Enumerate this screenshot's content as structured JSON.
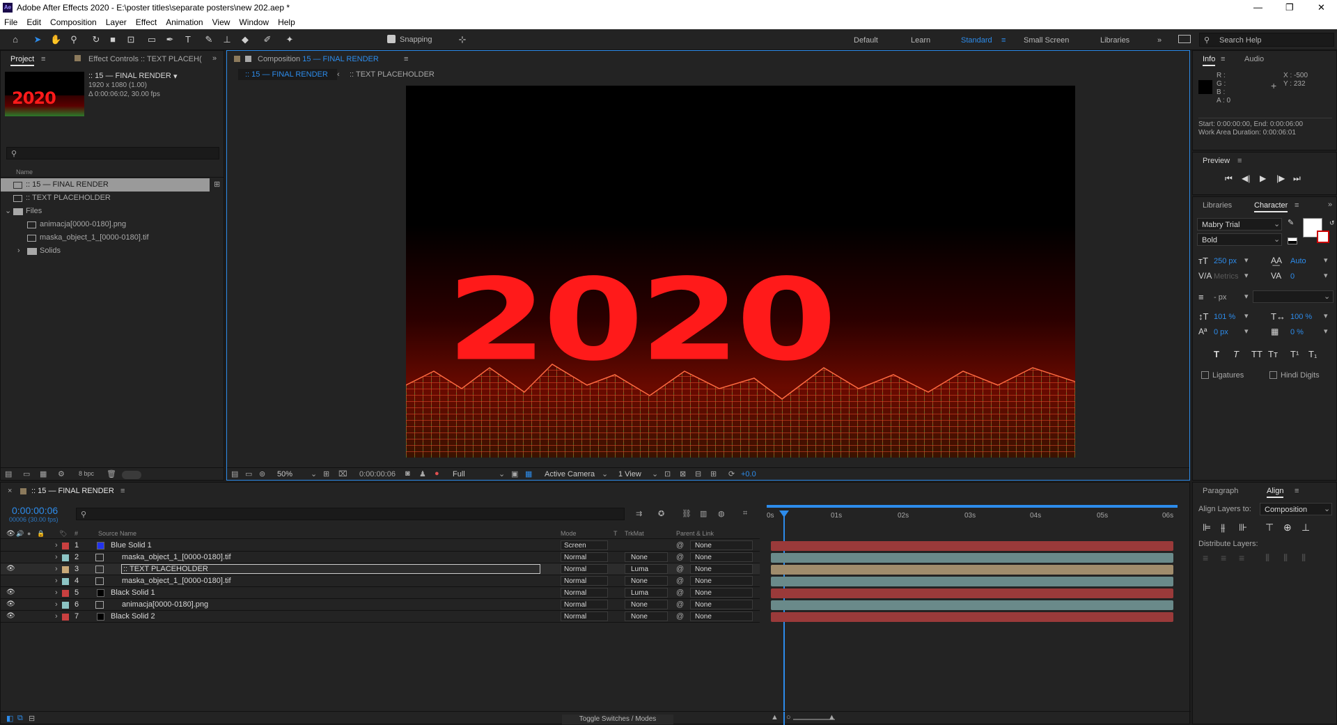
{
  "window": {
    "title": "Adobe After Effects 2020 - E:\\poster titles\\separate posters\\new 202.aep *",
    "app_icon": "Ae",
    "minimize": "—",
    "maximize": "❐",
    "close": "✕"
  },
  "menu": [
    "File",
    "Edit",
    "Composition",
    "Layer",
    "Effect",
    "Animation",
    "View",
    "Window",
    "Help"
  ],
  "toolbar": {
    "snapping": "Snapping",
    "workspaces": [
      "Default",
      "Learn",
      "Standard",
      "Small Screen",
      "Libraries"
    ],
    "active_workspace": "Standard",
    "search_placeholder": "Search Help"
  },
  "project": {
    "tab": "Project",
    "effect_tab": "Effect Controls :: TEXT PLACEH(",
    "comp_name": ":: 15 — FINAL RENDER",
    "comp_res": "1920 x 1080 (1.00)",
    "comp_dur": "Δ 0:00:06:02, 30.00 fps",
    "thumb_text": "2020",
    "col_name": "Name",
    "items": [
      {
        "label": ":: 15 — FINAL RENDER",
        "indent": 0
      },
      {
        "label": ":: TEXT PLACEHOLDER",
        "indent": 0
      },
      {
        "label": "Files",
        "indent": 0
      },
      {
        "label": "animacja[0000-0180].png",
        "indent": 1
      },
      {
        "label": "maska_object_1_[0000-0180].tif",
        "indent": 1
      },
      {
        "label": "Solids",
        "indent": 1
      }
    ],
    "bpc": "8 bpc"
  },
  "composition": {
    "tab_prefix": "Composition",
    "tab_name": "15 — FINAL RENDER",
    "crumbs": [
      ":: 15 — FINAL RENDER",
      ":: TEXT PLACEHOLDER"
    ],
    "art_text": "2020",
    "zoom": "50%",
    "timecode": "0:00:00:06",
    "resolution": "Full",
    "camera": "Active Camera",
    "views": "1 View",
    "exposure": "+0.0"
  },
  "info": {
    "tab": "Info",
    "audio_tab": "Audio",
    "r": "R :",
    "g": "G :",
    "b": "B :",
    "a": "A : 0",
    "x": "X : -500",
    "y": "Y : 232",
    "start": "Start: 0:00:00:00, End: 0:00:06:00",
    "work": "Work Area Duration: 0:00:06:01"
  },
  "preview": {
    "tab": "Preview"
  },
  "character": {
    "lib_tab": "Libraries",
    "tab": "Character",
    "font": "Mabry Trial",
    "style": "Bold",
    "size": "250 px",
    "leading": "Auto",
    "kerning": "Metrics",
    "tracking": "0",
    "stroke": "- px",
    "vscale": "101 %",
    "hscale": "100 %",
    "baseline": "0 px",
    "tsume": "0 %",
    "styles": [
      "T",
      "T",
      "TT",
      "Tт",
      "T¹",
      "T₁"
    ],
    "ligatures": "Ligatures",
    "hindi": "Hindi Digits"
  },
  "align": {
    "para_tab": "Paragraph",
    "tab": "Align",
    "align_to_label": "Align Layers to:",
    "align_to": "Composition",
    "distribute": "Distribute Layers:"
  },
  "timeline": {
    "tab": ":: 15 — FINAL RENDER",
    "timecode": "0:00:00:06",
    "frames": "00006 (30.00 fps)",
    "headers": {
      "num": "#",
      "source": "Source Name",
      "mode": "Mode",
      "t": "T",
      "trkmat": "TrkMat",
      "parent": "Parent & Link"
    },
    "ruler": [
      "0s",
      "01s",
      "02s",
      "03s",
      "04s",
      "05s",
      "06s"
    ],
    "layers": [
      {
        "n": "1",
        "name": "Blue Solid 1",
        "label_color": "#c94040",
        "icon_color": "#2233ee",
        "mode": "Screen",
        "trkmat": "",
        "parent": "None",
        "bar": "#9a3a3a",
        "eye": ""
      },
      {
        "n": "2",
        "name": "maska_object_1_[0000-0180].tif",
        "label_color": "#8cc4c4",
        "icon_color": "",
        "mode": "Normal",
        "trkmat": "None",
        "parent": "None",
        "bar": "#6a8a8a",
        "eye": ""
      },
      {
        "n": "3",
        "name": ":: TEXT PLACEHOLDER",
        "label_color": "#c8a878",
        "icon_color": "",
        "mode": "Normal",
        "trkmat": "Luma",
        "parent": "None",
        "bar": "#a08c6c",
        "eye": "👁"
      },
      {
        "n": "4",
        "name": "maska_object_1_[0000-0180].tif",
        "label_color": "#8cc4c4",
        "icon_color": "",
        "mode": "Normal",
        "trkmat": "None",
        "parent": "None",
        "bar": "#6a8a8a",
        "eye": ""
      },
      {
        "n": "5",
        "name": "Black Solid 1",
        "label_color": "#c94040",
        "icon_color": "#000000",
        "mode": "Normal",
        "trkmat": "Luma",
        "parent": "None",
        "bar": "#9a3a3a",
        "eye": "👁"
      },
      {
        "n": "6",
        "name": "animacja[0000-0180].png",
        "label_color": "#8cc4c4",
        "icon_color": "",
        "mode": "Normal",
        "trkmat": "None",
        "parent": "None",
        "bar": "#6a8a8a",
        "eye": "👁"
      },
      {
        "n": "7",
        "name": "Black Solid 2",
        "label_color": "#c94040",
        "icon_color": "#000000",
        "mode": "Normal",
        "trkmat": "None",
        "parent": "None",
        "bar": "#9a3a3a",
        "eye": "👁"
      }
    ],
    "toggle": "Toggle Switches / Modes"
  },
  "colors": {
    "accent": "#2d8ceb",
    "red_text": "#ff1a1a"
  }
}
